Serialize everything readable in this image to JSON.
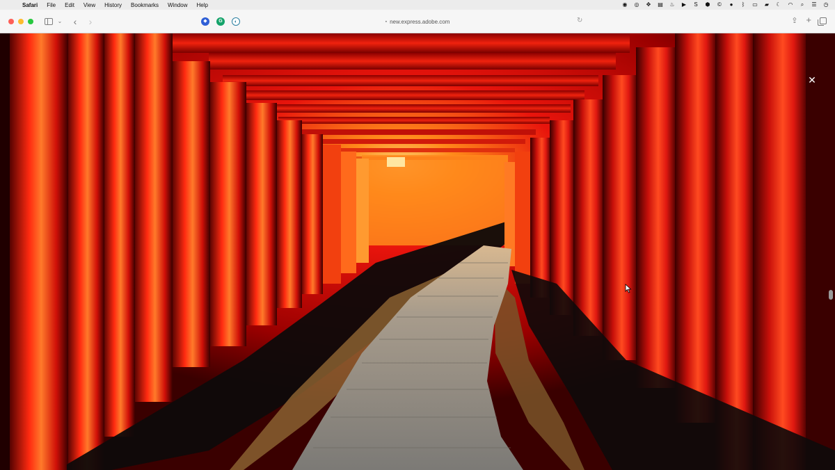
{
  "menubar": {
    "app_name": "Safari",
    "items": [
      "File",
      "Edit",
      "View",
      "History",
      "Bookmarks",
      "Window",
      "Help"
    ]
  },
  "toolbar": {
    "url": "new.express.adobe.com",
    "extensions": [
      "shield-extension",
      "grammarly-extension",
      "accessibility-extension"
    ]
  },
  "viewer": {
    "close_label": "✕"
  },
  "icons": {
    "apple": "apple-icon",
    "back": "chevron-left-icon",
    "forward": "chevron-right-icon",
    "reload": "reload-icon",
    "share": "share-icon",
    "new_tab": "plus-icon",
    "tabs": "tab-overview-icon"
  },
  "colors": {
    "torii_red": "#e0140f",
    "torii_dark": "#7a0000",
    "glow": "#ffb020",
    "path": "#9a9488"
  }
}
